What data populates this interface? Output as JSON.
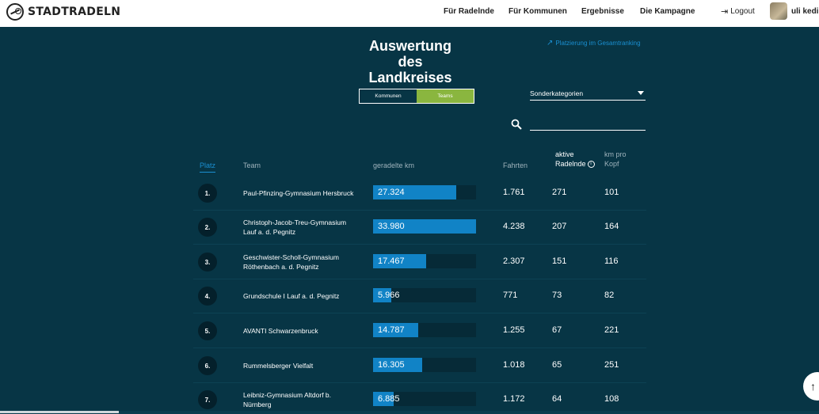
{
  "brand": {
    "name": "STADTRADELN"
  },
  "nav": {
    "items": [
      {
        "label": "Für Radelnde"
      },
      {
        "label": "Für Kommunen"
      },
      {
        "label": "Ergebnisse"
      },
      {
        "label": "Die Kampagne"
      }
    ],
    "logout": "Logout",
    "user_name": "uli kedin"
  },
  "page": {
    "title": "Auswertung des Landkreises",
    "ranking_link": "Platzierung im Gesamtranking"
  },
  "toggle": {
    "options": [
      {
        "label": "Kommunen",
        "active": false
      },
      {
        "label": "Teams",
        "active": true
      }
    ]
  },
  "filter": {
    "selected": "Sonderkategorien"
  },
  "search": {
    "placeholder": "",
    "value": ""
  },
  "table": {
    "headers": {
      "platz": "Platz",
      "team": "Team",
      "km": "geradelte km",
      "fahrten": "Fahrten",
      "aktive_line1": "aktive",
      "aktive_line2": "Radelnde",
      "kopf_line1": "km pro",
      "kopf_line2": "Kopf"
    },
    "max_km": 33980,
    "rows": [
      {
        "platz": "1.",
        "team_l1": "Paul-Pfinzing-Gymnasium Hersbruck",
        "team_l2": "",
        "km": "27.324",
        "km_value": 27324,
        "fahrten": "1.761",
        "aktive": "271",
        "kopf": "101"
      },
      {
        "platz": "2.",
        "team_l1": "Christoph-Jacob-Treu-Gymnasium",
        "team_l2": "Lauf a. d. Pegnitz",
        "km": "33.980",
        "km_value": 33980,
        "fahrten": "4.238",
        "aktive": "207",
        "kopf": "164"
      },
      {
        "platz": "3.",
        "team_l1": "Geschwister-Scholl-Gymnasium",
        "team_l2": "Röthenbach a. d. Pegnitz",
        "km": "17.467",
        "km_value": 17467,
        "fahrten": "2.307",
        "aktive": "151",
        "kopf": "116"
      },
      {
        "platz": "4.",
        "team_l1": "Grundschule I Lauf a. d. Pegnitz",
        "team_l2": "",
        "km": "5.966",
        "km_value": 5966,
        "fahrten": "771",
        "aktive": "73",
        "kopf": "82"
      },
      {
        "platz": "5.",
        "team_l1": "AVANTI Schwarzenbruck",
        "team_l2": "",
        "km": "14.787",
        "km_value": 14787,
        "fahrten": "1.255",
        "aktive": "67",
        "kopf": "221"
      },
      {
        "platz": "6.",
        "team_l1": "Rummelsberger Vielfalt",
        "team_l2": "",
        "km": "16.305",
        "km_value": 16305,
        "fahrten": "1.018",
        "aktive": "65",
        "kopf": "251"
      },
      {
        "platz": "7.",
        "team_l1": "Leibniz-Gymnasium Altdorf b.",
        "team_l2": "Nürnberg",
        "km": "6.885",
        "km_value": 6885,
        "fahrten": "1.172",
        "aktive": "64",
        "kopf": "108"
      }
    ]
  },
  "colors": {
    "background": "#073545",
    "accent_green": "#8ab63f",
    "bar_blue": "#1183c6",
    "link_blue": "#1a8fd1"
  },
  "icons": {
    "logo": "bike-logo-icon",
    "logout": "logout-icon",
    "search": "search-icon",
    "info": "info-icon",
    "link": "arrow-up-right-icon",
    "dropdown": "caret-down-icon",
    "scroll": "arrow-up-icon"
  }
}
